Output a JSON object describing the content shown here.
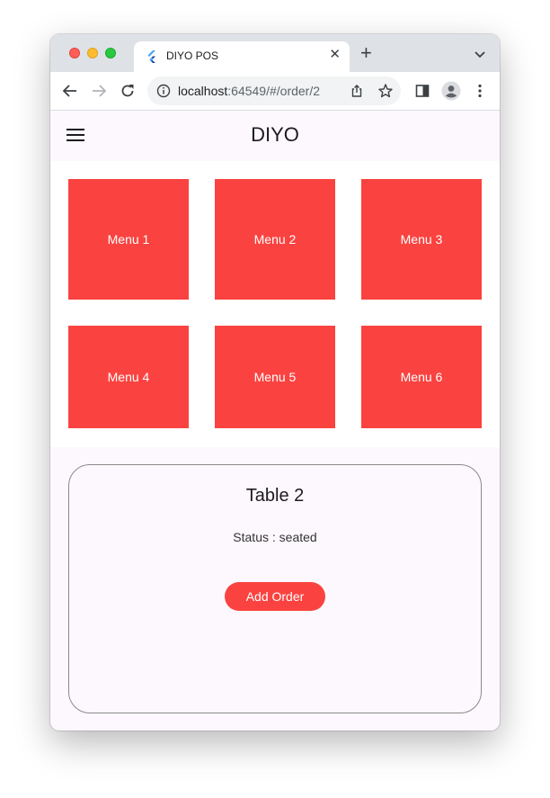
{
  "browser": {
    "tab_title": "DIYO POS",
    "tab_close": "✕",
    "new_tab": "+",
    "url_host": "localhost",
    "url_rest": ":64549/#/order/2"
  },
  "app": {
    "title": "DIYO"
  },
  "menus": [
    {
      "label": "Menu 1"
    },
    {
      "label": "Menu 2"
    },
    {
      "label": "Menu 3"
    },
    {
      "label": "Menu 4"
    },
    {
      "label": "Menu 5"
    },
    {
      "label": "Menu 6"
    }
  ],
  "table_card": {
    "title": "Table 2",
    "status": "Status : seated",
    "add_order_label": "Add Order"
  },
  "colors": {
    "accent": "#fa4340",
    "background": "#fdf8fd",
    "tabstrip": "#dee1e6"
  }
}
